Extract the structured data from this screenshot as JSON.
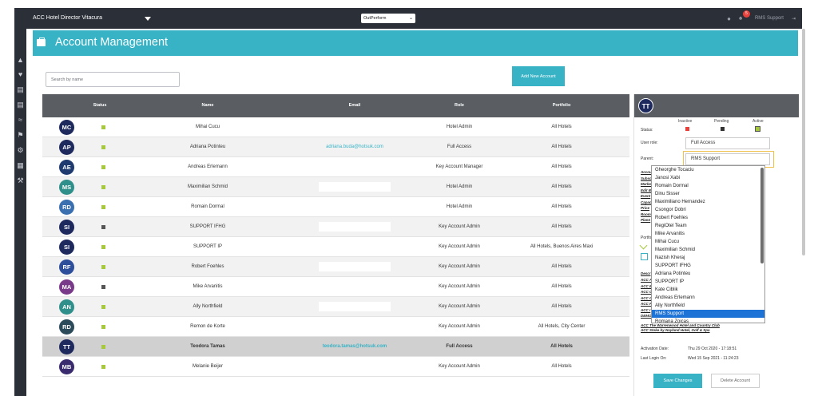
{
  "topbar": {
    "hotel": "ACC Hotel Director Vitacura",
    "product": "OutPerform",
    "notification_count": "5",
    "user": "RMS Support"
  },
  "page": {
    "title": "Account Management"
  },
  "search": {
    "placeholder": "Search by name"
  },
  "add_button": "Add New Account",
  "table": {
    "headers": {
      "status": "Status",
      "name": "Name",
      "email": "Email",
      "role": "Role",
      "portfolio": "Portfolio"
    },
    "rows": [
      {
        "initials": "MC",
        "avatar_color": "#1e2a5e",
        "status": "active",
        "name": "Mihai Cucu",
        "email": "",
        "role": "Hotel Admin",
        "portfolio": "All Hotels"
      },
      {
        "initials": "AP",
        "avatar_color": "#1e2a5e",
        "status": "active",
        "name": "Adriana Potinteu",
        "email": "adriana.buda@hotsuk.com",
        "role": "Full Access",
        "portfolio": "All Hotels"
      },
      {
        "initials": "AE",
        "avatar_color": "#1e3a6e",
        "status": "active",
        "name": "Andreas Erlemann",
        "email": "",
        "role": "Key Account Manager",
        "portfolio": "All Hotels"
      },
      {
        "initials": "MS",
        "avatar_color": "#2f8f8a",
        "status": "active",
        "name": "Maximilian Schmid",
        "email": "",
        "role": "Hotel Admin",
        "portfolio": "All Hotels"
      },
      {
        "initials": "RD",
        "avatar_color": "#3a6fb0",
        "status": "active",
        "name": "Romain Dormal",
        "email": "",
        "role": "Hotel Admin",
        "portfolio": "All Hotels"
      },
      {
        "initials": "SI",
        "avatar_color": "#1e2a5e",
        "status": "inactive",
        "name": "SUPPORT IFHG",
        "email": "",
        "role": "Key Account Admin",
        "portfolio": "All Hotels"
      },
      {
        "initials": "SI",
        "avatar_color": "#1e2a5e",
        "status": "active",
        "name": "SUPPORT IP",
        "email": "",
        "role": "Key Account Admin",
        "portfolio": "All Hotels, Buenos Aires Maxi"
      },
      {
        "initials": "RF",
        "avatar_color": "#2d4e9a",
        "status": "active",
        "name": "Robert Foehles",
        "email": "",
        "role": "Key Account Admin",
        "portfolio": "All Hotels"
      },
      {
        "initials": "MA",
        "avatar_color": "#7a3a8a",
        "status": "inactive",
        "name": "Mike Arvanitis",
        "email": "",
        "role": "Key Account Admin",
        "portfolio": "All Hotels"
      },
      {
        "initials": "AN",
        "avatar_color": "#2f8f8a",
        "status": "active",
        "name": "Ally Northfield",
        "email": "",
        "role": "Key Account Admin",
        "portfolio": "All Hotels"
      },
      {
        "initials": "RD",
        "avatar_color": "#2b4a5a",
        "status": "active",
        "name": "Remon de Korte",
        "email": "",
        "role": "Key Account Admin",
        "portfolio": "All Hotels, City Center"
      },
      {
        "initials": "TT",
        "avatar_color": "#1e2a5e",
        "status": "active",
        "name": "Teodora Tamas",
        "email": "teodora.tamas@hotsuk.com",
        "role": "Full Access",
        "portfolio": "All Hotels"
      },
      {
        "initials": "MB",
        "avatar_color": "#3a2a6e",
        "status": "active",
        "name": "Melanie Beijer",
        "email": "",
        "role": "Key Account Admin",
        "portfolio": "All Hotels"
      }
    ]
  },
  "status_colors": {
    "active": "#a5c93b",
    "inactive": "#555555",
    "pending": "#333333",
    "inactive_legend": "#e8413c"
  },
  "panel": {
    "initials": "TT",
    "status_label": "Status:",
    "legend": {
      "inactive": "Inactive",
      "pending": "Pending",
      "active": "Active"
    },
    "user_role_label": "User role:",
    "user_role_value": "Full Access",
    "parent_label": "Parent:",
    "parent_value": "RMS Support",
    "side_labels": [
      "Accou",
      "Subsc",
      "Marke",
      "Edit B",
      "Event",
      "Capac",
      "Price",
      "Room",
      "Plann"
    ],
    "portfolio_label": "Portfo",
    "desc_label": "Descr",
    "acc_labels": [
      "ACC A",
      "ACC B",
      "ACC C",
      "ACC C",
      "ACC F",
      "ACC I",
      "DEMO"
    ],
    "acc_bottom": [
      "ACC The Warrenwood Hotel and Country Club",
      "ACC Stoke by Nayland Hotel, Golf & Spa"
    ],
    "dropdown_items": [
      "Gheorghe Tocaciu",
      "Janosi Xabi",
      "Romain Dormal",
      "Dinu Sisser",
      "Maximiliano Hernandez",
      "Csongor Dobri",
      "Robert Foehles",
      "RegiOtel Team",
      "Mike Arvanitis",
      "Mihai Cucu",
      "Maximilian Schmid",
      "Nazish Kheraj",
      "SUPPORT IFHG",
      "Adriana Potinteu",
      "SUPPORT IP",
      "Kate Ciblik",
      "Andreas Erlemann",
      "Ally Northfield",
      "RMS Support",
      "Romana Zoicas"
    ],
    "dropdown_selected": "RMS Support",
    "activation_label": "Activation Date:",
    "activation_value": "Thu 29 Oct 2020 - 17:18:51",
    "last_login_label": "Last Login On:",
    "last_login_value": "Wed 15 Sep 2021 - 11:24:23",
    "save_label": "Save Changes",
    "delete_label": "Delete Account"
  }
}
